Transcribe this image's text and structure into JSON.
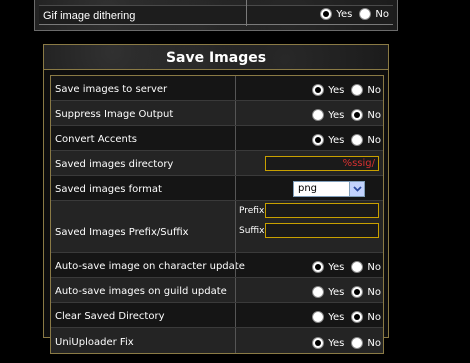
{
  "top_row": {
    "label": "Gif image dithering",
    "options": [
      {
        "label": "Yes",
        "checked": true
      },
      {
        "label": "No",
        "checked": false
      }
    ]
  },
  "panel": {
    "title": "Save Images"
  },
  "rows": [
    {
      "label": "Save images to server",
      "yes": "Yes",
      "no": "No",
      "selected": "Yes"
    },
    {
      "label": "Suppress Image Output",
      "yes": "Yes",
      "no": "No",
      "selected": "No"
    },
    {
      "label": "Convert Accents",
      "yes": "Yes",
      "no": "No",
      "selected": "Yes"
    },
    {
      "label": "Saved images directory",
      "value": "%ssig/"
    },
    {
      "label": "Saved images format",
      "value": "png"
    },
    {
      "label": "Saved Images Prefix/Suffix",
      "prefix_label": "Prefix:",
      "suffix_label": "Suffix:",
      "prefix_value": "",
      "suffix_value": ""
    },
    {
      "label": "Auto-save image on character update",
      "yes": "Yes",
      "no": "No",
      "selected": "Yes"
    },
    {
      "label": "Auto-save images on guild update",
      "yes": "Yes",
      "no": "No",
      "selected": "No"
    },
    {
      "label": "Clear Saved Directory",
      "yes": "Yes",
      "no": "No",
      "selected": "No"
    },
    {
      "label": "UniUploader Fix",
      "yes": "Yes",
      "no": "No",
      "selected": "Yes"
    }
  ],
  "colors": {
    "accent_border": "#8a7a45",
    "input_border": "#c8a000",
    "input_text": "#d83030"
  }
}
